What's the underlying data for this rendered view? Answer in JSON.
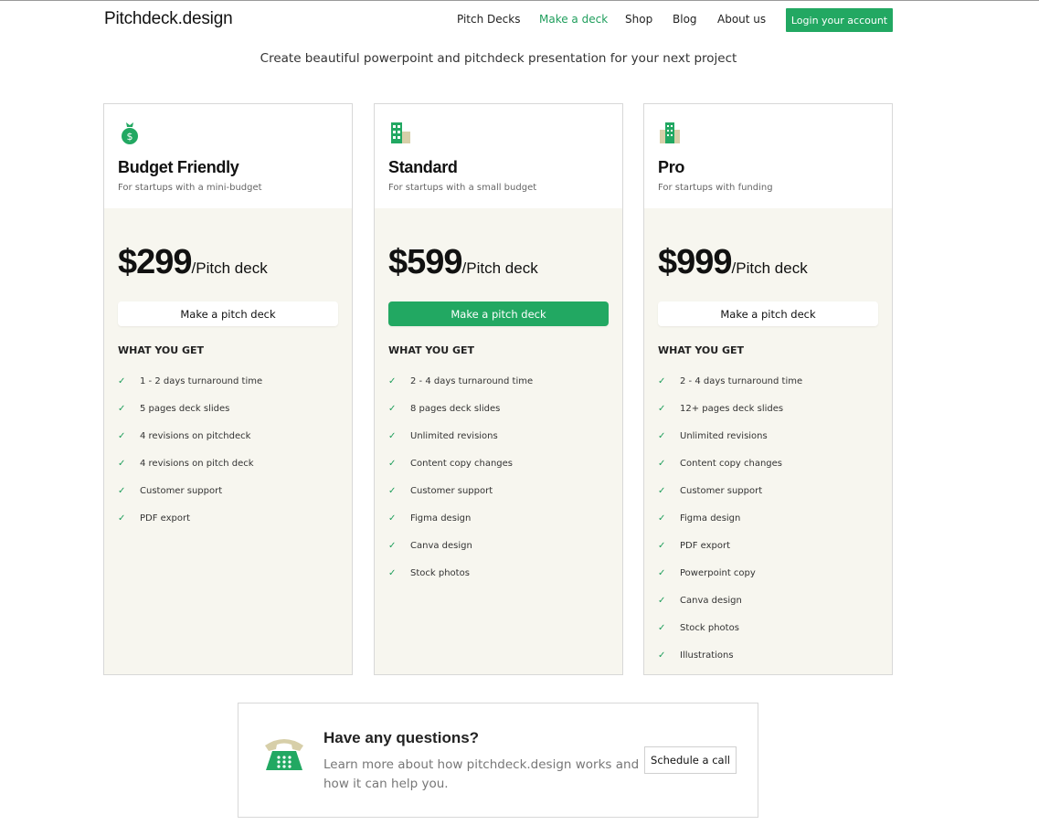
{
  "header": {
    "logo": "Pitchdeck.design",
    "nav": [
      "Pitch Decks",
      "Make a deck",
      "Shop",
      "Blog",
      "About us"
    ],
    "login": "Login your account",
    "accent": "#22a862"
  },
  "subtitle": "Create beautiful powerpoint and pitchdeck presentation for your next project",
  "plans": [
    {
      "icon": "money-bag-icon",
      "title": "Budget Friendly",
      "sub": "For startups with a mini-budget",
      "price": "$299",
      "unit": "/Pitch deck",
      "cta": "Make a pitch deck",
      "what": "WHAT YOU GET",
      "features": [
        "1 - 2 days turnaround time",
        "5 pages deck slides",
        "4 revisions on pitchdeck",
        "4 revisions on pitch deck",
        "Customer support",
        "PDF export"
      ]
    },
    {
      "icon": "buildings-icon",
      "title": "Standard",
      "sub": "For startups with a small budget",
      "price": "$599",
      "unit": "/Pitch deck",
      "cta": "Make a pitch deck",
      "what": "WHAT YOU GET",
      "features": [
        "2 - 4 days turnaround time",
        "8 pages deck slides",
        "Unlimited revisions",
        "Content copy changes",
        "Customer support",
        "Figma design",
        "Canva design",
        "Stock photos"
      ]
    },
    {
      "icon": "office-tower-icon",
      "title": "Pro",
      "sub": "For startups with funding",
      "price": "$999",
      "unit": "/Pitch deck",
      "cta": "Make a pitch deck",
      "what": "WHAT YOU GET",
      "features": [
        "2 - 4 days turnaround time",
        "12+ pages deck slides",
        "Unlimited revisions",
        "Content copy changes",
        "Customer support",
        "Figma design",
        "PDF export",
        "Powerpoint copy",
        "Canva design",
        "Stock photos",
        "Illustrations"
      ]
    }
  ],
  "questions": {
    "title": "Have any questions?",
    "text": "Learn more about how pitchdeck.design works and how it can help you.",
    "button": "Schedule a call"
  }
}
